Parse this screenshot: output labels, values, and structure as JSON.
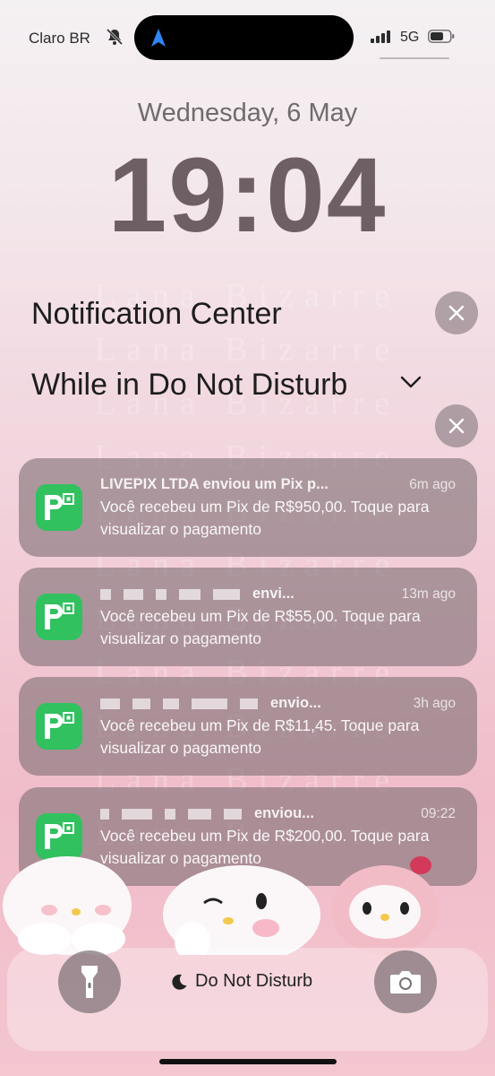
{
  "status_bar": {
    "carrier": "Claro BR",
    "network": "5G",
    "icons": [
      "bell-slash-icon",
      "location-arrow-icon",
      "signal-bars-icon",
      "battery-icon"
    ]
  },
  "lock": {
    "date": "Wednesday, 6 May",
    "time": "19:04"
  },
  "notification_center": {
    "title": "Notification Center",
    "group_title": "While in Do Not Disturb"
  },
  "watermark": "Lana Bizarre",
  "notifications": [
    {
      "title": "LIVEPIX LTDA enviou um Pix p...",
      "time": "6m ago",
      "body": "Você recebeu um Pix de R$950,00. Toque para visualizar o pagamento",
      "icon": "picpay-icon"
    },
    {
      "title": "envi...",
      "time": "13m ago",
      "body": "Você recebeu um Pix de R$55,00. Toque para visualizar o pagamento",
      "icon": "picpay-icon"
    },
    {
      "title": "envio...",
      "time": "3h ago",
      "body": "Você recebeu um Pix de R$11,45. Toque para visualizar o pagamento",
      "icon": "picpay-icon"
    },
    {
      "title": "enviou...",
      "time": "09:22",
      "body": "Você recebeu um Pix de R$200,00. Toque para visualizar o pagamento",
      "icon": "picpay-icon"
    }
  ],
  "bottom": {
    "focus_label": "Do Not Disturb",
    "left_icon": "flashlight-icon",
    "right_icon": "camera-icon"
  },
  "colors": {
    "app_green": "#31c15f",
    "card_bg": "#786a70",
    "time_color": "#6d5f64"
  }
}
